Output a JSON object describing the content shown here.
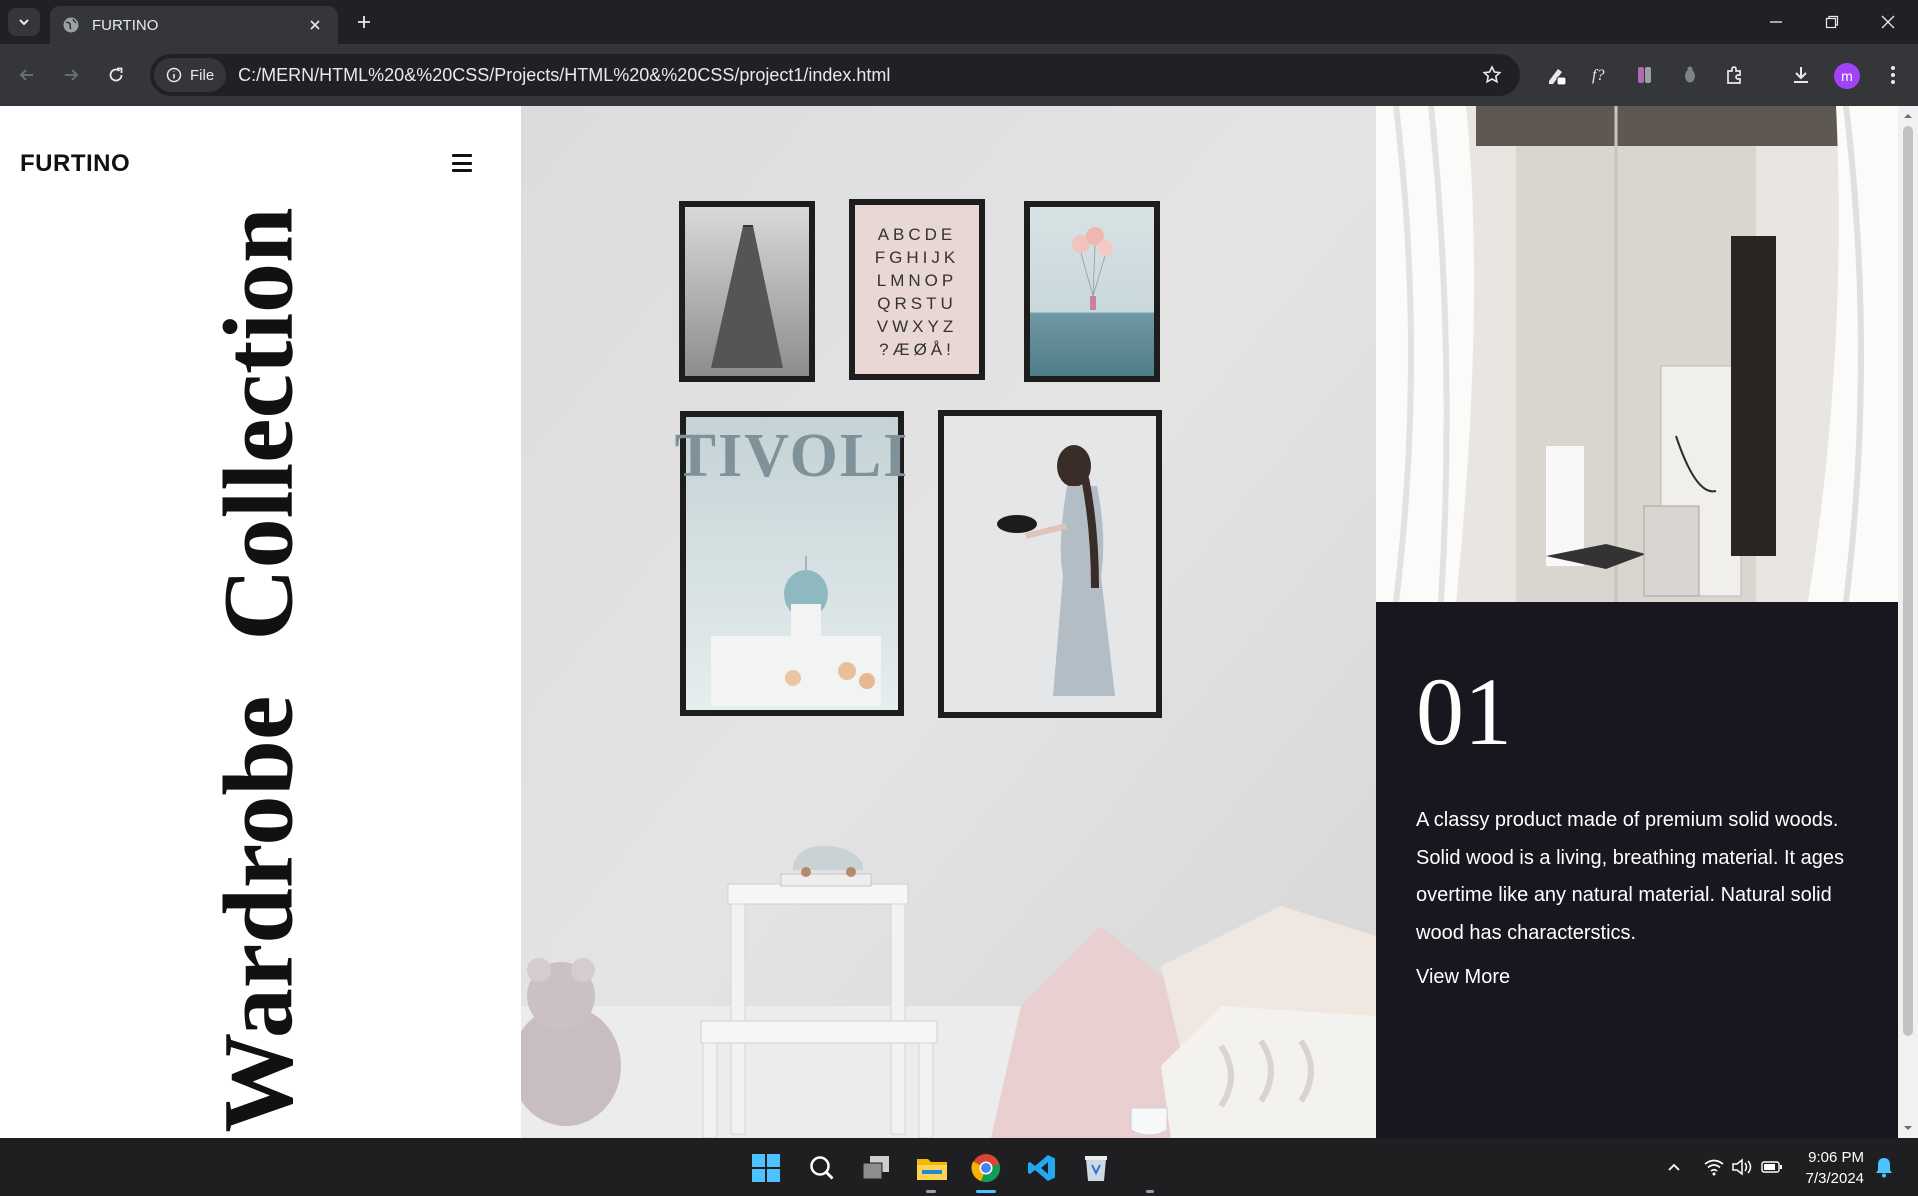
{
  "browser": {
    "tab_title": "FURTINO",
    "chip_label": "File",
    "url": "C:/MERN/HTML%20&%20CSS/Projects/HTML%20&%20CSS/project1/index.html",
    "profile_initial": "m"
  },
  "page": {
    "logo": "FURTINO",
    "vertical_title": "Wardrobe Collection",
    "info": {
      "number": "01",
      "description": "A classy product made of premium solid woods. Solid wood is a living, breathing material. It ages overtime like any natural material. Natural solid wood has characterstics.",
      "link_label": "View More"
    },
    "hero_poster_text": "TIVOLI",
    "alphabet_rows": [
      "ABCDE",
      "FGHIJK",
      "LMNOP",
      "QRSTU",
      "VWXYZ",
      "?ÆØÅ!"
    ]
  },
  "taskbar": {
    "time": "9:06 PM",
    "date": "7/3/2024"
  },
  "colors": {
    "info_panel_bg": "#19161f",
    "chrome_dark": "#202124",
    "chrome_toolbar": "#35363a"
  }
}
